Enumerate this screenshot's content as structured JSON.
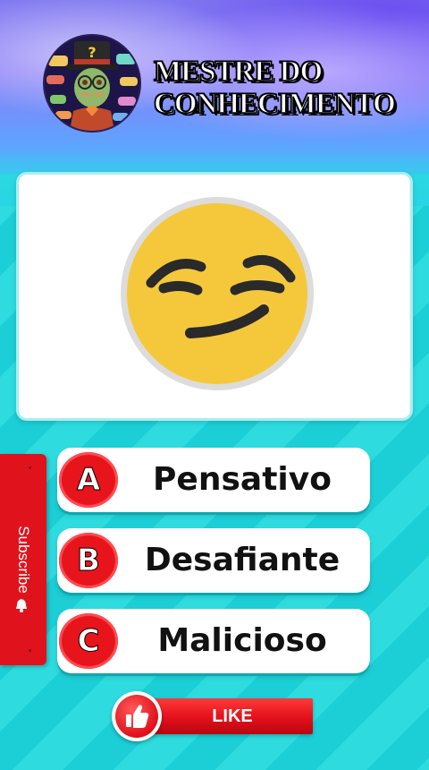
{
  "header": {
    "title_line1": "MESTRE DO",
    "title_line2": "CONHECIMENTO",
    "avatar_icon": "mustached-man-top-hat-avatar"
  },
  "question": {
    "emoji_icon": "smirking-face-emoji",
    "emoji_color": "#f7c93a"
  },
  "answers": [
    {
      "letter": "A",
      "text": "Pensativo"
    },
    {
      "letter": "B",
      "text": "Desafiante"
    },
    {
      "letter": "C",
      "text": "Malicioso"
    }
  ],
  "subscribe": {
    "label": "Subscribe",
    "icon": "bell-icon"
  },
  "like": {
    "label": "LIKE",
    "icon": "thumbs-up-icon"
  },
  "colors": {
    "accent_red": "#e8141c",
    "background_teal": "#1fd6da",
    "header_purple": "#7f77f0"
  }
}
